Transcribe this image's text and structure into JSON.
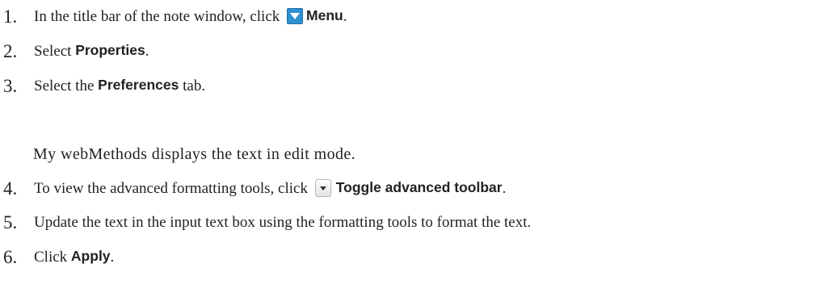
{
  "steps": [
    {
      "number": "1.",
      "before": "In the title bar of the note window, click ",
      "icon": "menu-icon",
      "ui": "Menu",
      "after": "."
    },
    {
      "number": "2.",
      "before": "Select ",
      "ui": "Properties",
      "after": "."
    },
    {
      "number": "3.",
      "before": "Select the ",
      "ui": "Preferences",
      "after": " tab."
    },
    {
      "number": "4.",
      "before": "To view the advanced formatting tools, click ",
      "icon": "toggle-dropdown-icon",
      "ui": "Toggle advanced toolbar",
      "after": "."
    },
    {
      "number": "5.",
      "text": "Update the text in the input text box using the formatting tools to format the text."
    },
    {
      "number": "6.",
      "before": "Click ",
      "ui": "Apply",
      "after": "."
    }
  ],
  "note": "My webMethods displays the text in edit mode.",
  "colors": {
    "menu_icon": "#2f8fd0",
    "text": "#222222"
  }
}
